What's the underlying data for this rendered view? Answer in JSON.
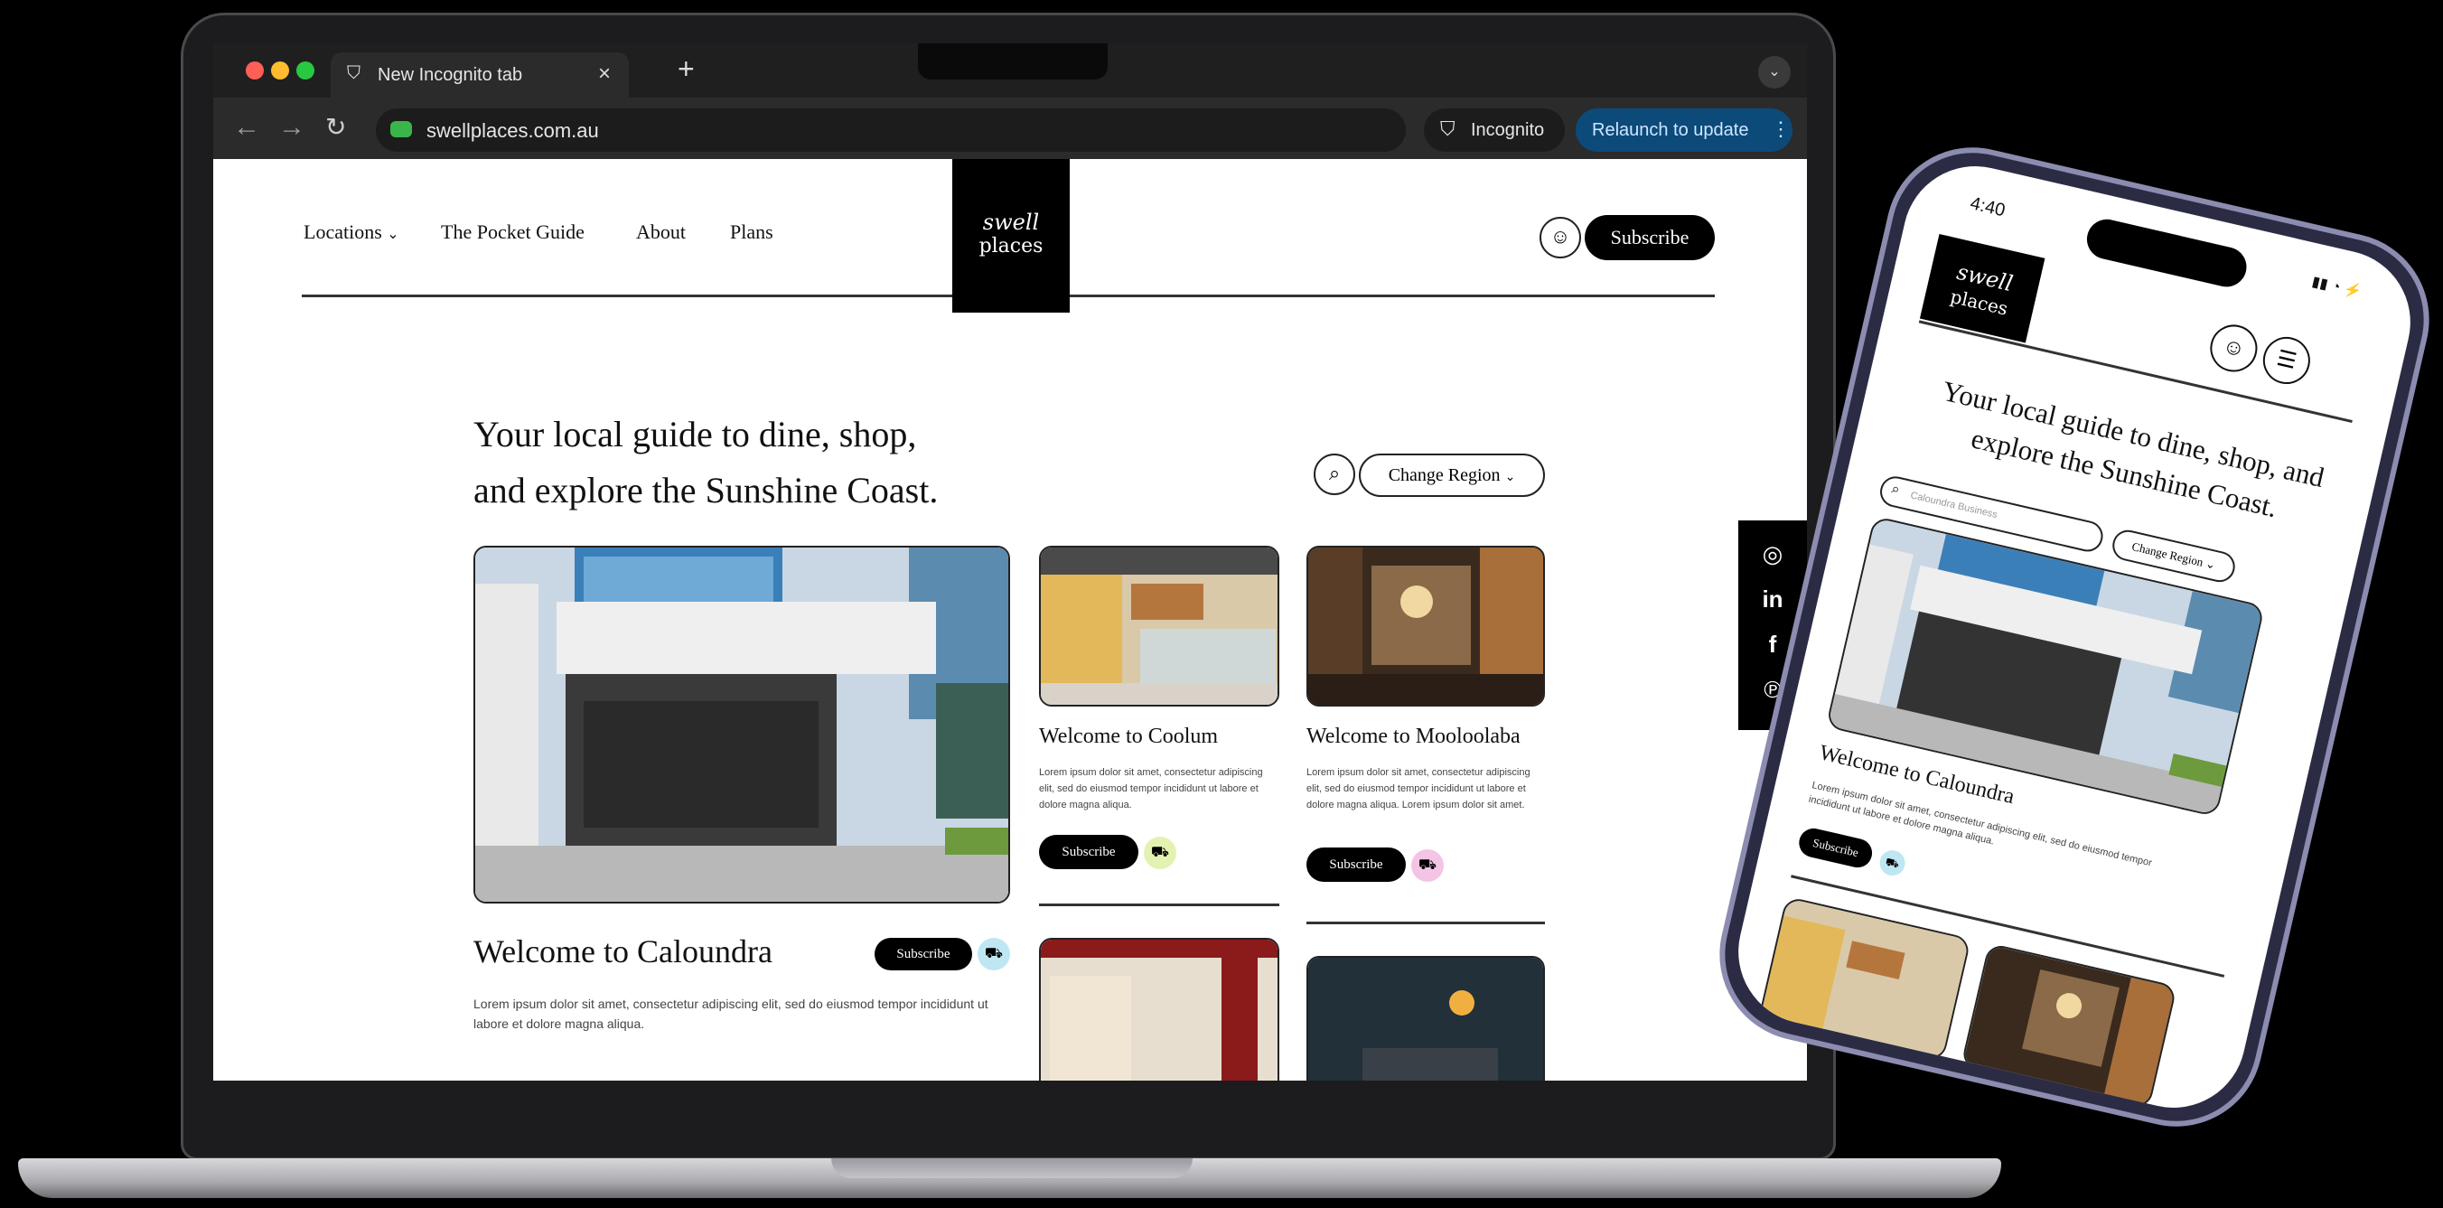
{
  "browser": {
    "tab_title": "New Incognito tab",
    "tab_close": "×",
    "new_tab": "+",
    "url": "swellplaces.com.au",
    "incognito_label": "Incognito",
    "relaunch_label": "Relaunch to update",
    "colors": {
      "traffic": [
        "#ff5f57",
        "#febc2e",
        "#28c840"
      ],
      "relaunch": "#0c4a7a"
    }
  },
  "site": {
    "nav": [
      "Locations",
      "The Pocket Guide",
      "About",
      "Plans"
    ],
    "nav_dropdown_glyph": "⌄",
    "logo_line1": "swell",
    "logo_line2": "places",
    "subscribe_label": "Subscribe",
    "hero_line1": "Your local guide to dine, shop,",
    "hero_line2": "and explore the Sunshine Coast.",
    "region_label": "Change Region",
    "cards": {
      "caloundra": {
        "title": "Welcome to Caloundra",
        "text": "Lorem ipsum dolor sit amet, consectetur adipiscing elit, sed do eiusmod tempor incididunt ut labore et dolore magna aliqua.",
        "subscribe": "Subscribe",
        "badge_color": "#bfe6f3"
      },
      "coolum": {
        "title": "Welcome to Coolum",
        "text": "Lorem ipsum dolor sit amet, consectetur adipiscing elit, sed do eiusmod tempor incididunt ut labore et dolore magna aliqua.",
        "subscribe": "Subscribe",
        "badge_color": "#e3f2b0"
      },
      "mooloolaba": {
        "title": "Welcome to Mooloolaba",
        "text": "Lorem ipsum dolor sit amet, consectetur adipiscing elit, sed do eiusmod tempor incididunt ut labore et dolore magna aliqua. Lorem ipsum dolor sit amet.",
        "subscribe": "Subscribe",
        "badge_color": "#f3c4e4"
      }
    },
    "social_icons": [
      "instagram-icon",
      "linkedin-icon",
      "facebook-icon",
      "pinterest-icon"
    ],
    "social_glyphs": [
      "◎",
      "in",
      "f",
      "℗"
    ]
  },
  "phone": {
    "time": "4:40",
    "status": "▮▮ ◔ ⚡",
    "logo_line1": "swell",
    "logo_line2": "places",
    "hero": "Your local guide to dine, shop, and explore the Sunshine Coast.",
    "search_placeholder": "Caloundra Business",
    "region_label": "Change Region",
    "card_title": "Welcome to Caloundra",
    "card_text": "Lorem ipsum dolor sit amet, consectetur adipiscing elit, sed do eiusmod tempor incididunt ut labore et dolore magna aliqua.",
    "subscribe": "Subscribe"
  }
}
